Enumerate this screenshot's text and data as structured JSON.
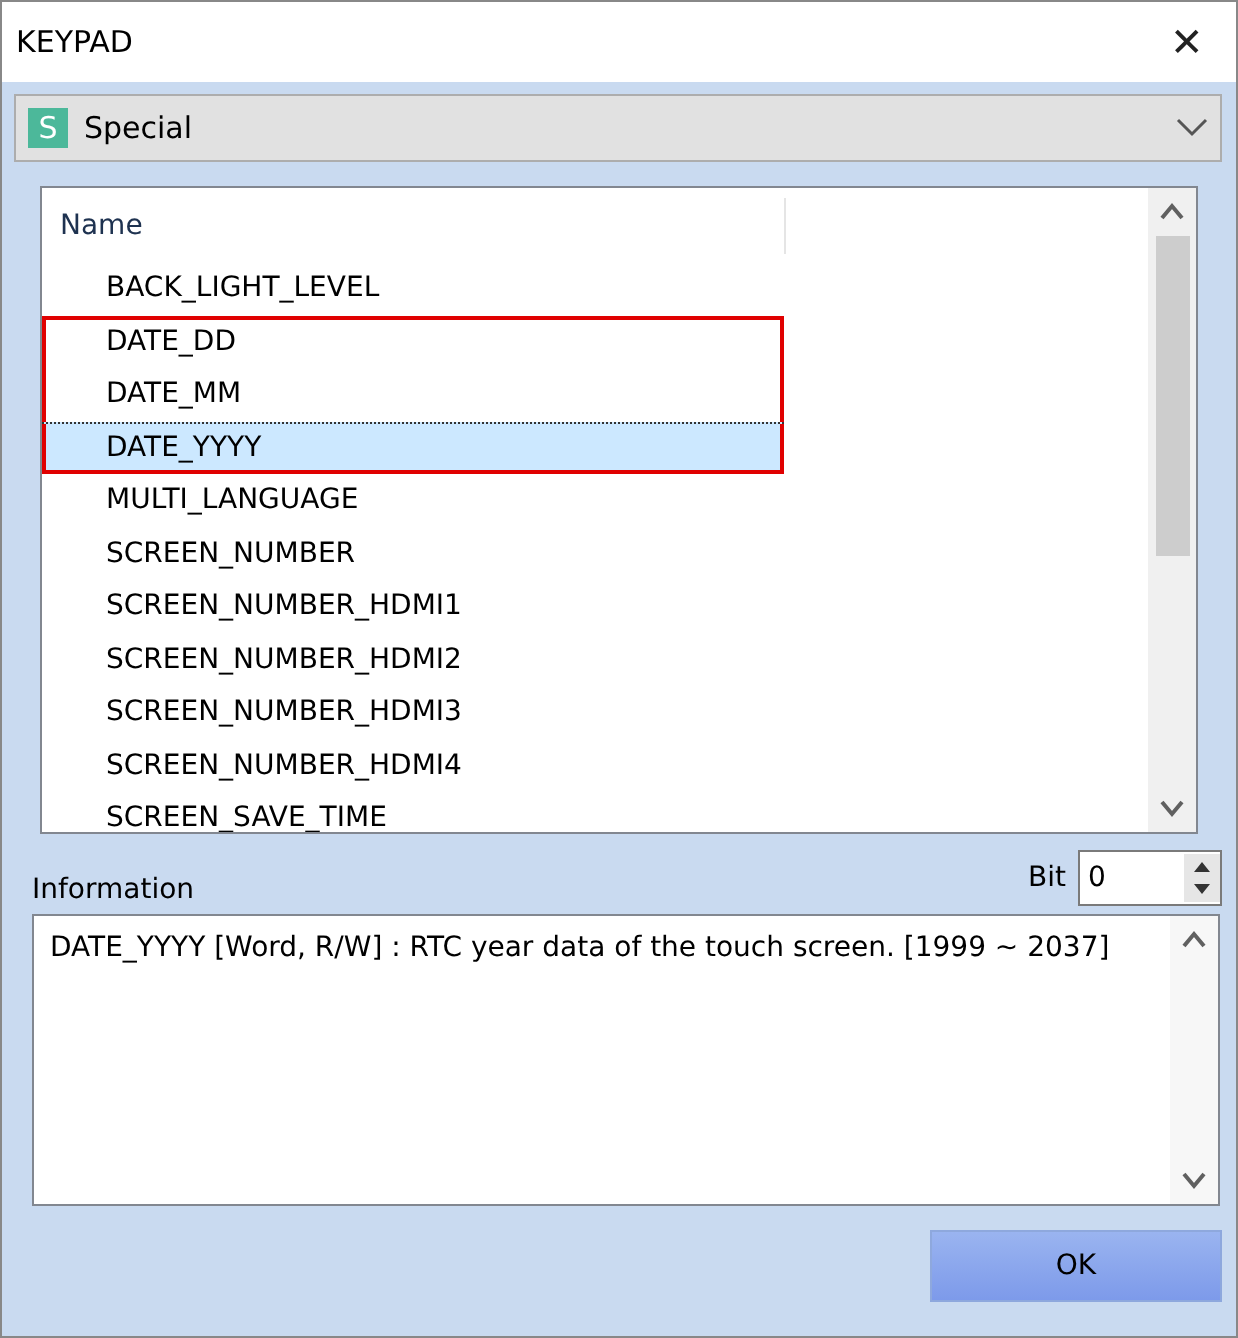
{
  "window": {
    "title": "KEYPAD",
    "close": "✕"
  },
  "category": {
    "icon_letter": "S",
    "value": "Special"
  },
  "list": {
    "columns": [
      "Name"
    ],
    "rows": [
      {
        "name": "BACK_LIGHT_LEVEL",
        "selected": false,
        "highlighted": false
      },
      {
        "name": "DATE_DD",
        "selected": false,
        "highlighted": true
      },
      {
        "name": "DATE_MM",
        "selected": false,
        "highlighted": true
      },
      {
        "name": "DATE_YYYY",
        "selected": true,
        "highlighted": true
      },
      {
        "name": "MULTI_LANGUAGE",
        "selected": false,
        "highlighted": false
      },
      {
        "name": "SCREEN_NUMBER",
        "selected": false,
        "highlighted": false
      },
      {
        "name": "SCREEN_NUMBER_HDMI1",
        "selected": false,
        "highlighted": false
      },
      {
        "name": "SCREEN_NUMBER_HDMI2",
        "selected": false,
        "highlighted": false
      },
      {
        "name": "SCREEN_NUMBER_HDMI3",
        "selected": false,
        "highlighted": false
      },
      {
        "name": "SCREEN_NUMBER_HDMI4",
        "selected": false,
        "highlighted": false
      },
      {
        "name": "SCREEN_SAVE_TIME",
        "selected": false,
        "highlighted": false
      }
    ]
  },
  "information": {
    "label": "Information",
    "text": "DATE_YYYY [Word, R/W] : RTC year data of the touch screen. [1999 ~ 2037]"
  },
  "bit": {
    "label": "Bit",
    "value": "0"
  },
  "buttons": [
    "OK"
  ]
}
